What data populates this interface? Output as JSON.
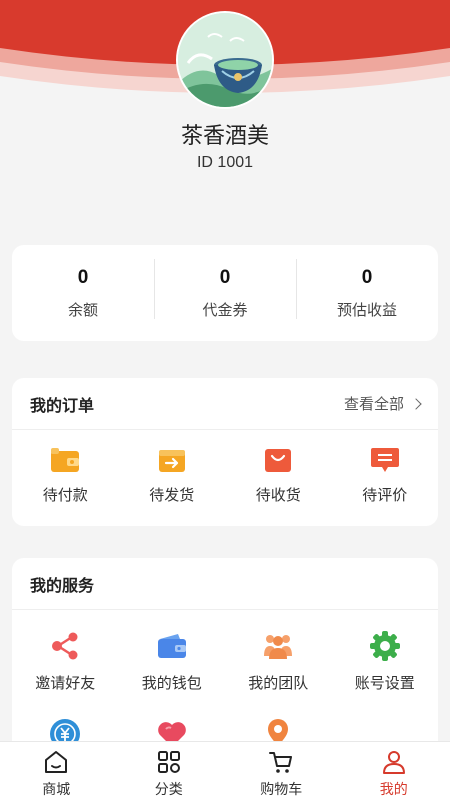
{
  "profile": {
    "name": "茶香酒美",
    "id_text": "ID 1001",
    "avatar_icon": "tea-cup-illustration"
  },
  "stats": [
    {
      "value": "0",
      "label": "余额"
    },
    {
      "value": "0",
      "label": "代金券"
    },
    {
      "value": "0",
      "label": "预估收益"
    }
  ],
  "orders": {
    "title": "我的订单",
    "more_label": "查看全部",
    "items": [
      {
        "label": "待付款",
        "icon": "wallet-icon"
      },
      {
        "label": "待发货",
        "icon": "box-arrow-icon"
      },
      {
        "label": "待收货",
        "icon": "shopping-bag-icon"
      },
      {
        "label": "待评价",
        "icon": "comment-icon"
      }
    ]
  },
  "services": {
    "title": "我的服务",
    "items": [
      {
        "label": "邀请好友",
        "icon": "share-icon"
      },
      {
        "label": "我的钱包",
        "icon": "wallet-icon"
      },
      {
        "label": "我的团队",
        "icon": "team-icon"
      },
      {
        "label": "账号设置",
        "icon": "gear-icon"
      },
      {
        "label": "",
        "icon": "yen-exchange-icon"
      },
      {
        "label": "",
        "icon": "heart-icon"
      },
      {
        "label": "",
        "icon": "location-pin-icon"
      }
    ]
  },
  "tabbar": {
    "items": [
      {
        "label": "商城",
        "icon": "home-icon"
      },
      {
        "label": "分类",
        "icon": "grid-icon"
      },
      {
        "label": "购物车",
        "icon": "cart-icon"
      },
      {
        "label": "我的",
        "icon": "user-icon",
        "active": true
      }
    ]
  },
  "colors": {
    "brand_red": "#d63a2c",
    "orange": "#f5a623",
    "accent_red": "#ee5a3b"
  }
}
